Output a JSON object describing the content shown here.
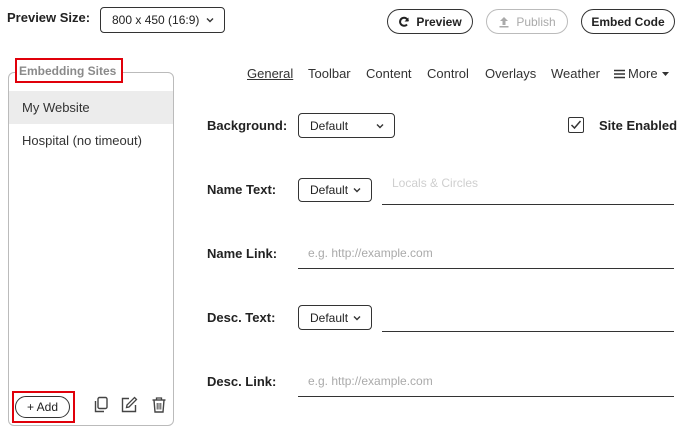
{
  "header": {
    "preview_size_label": "Preview Size:",
    "preview_size_value": "800 x 450 (16:9)",
    "preview_button": "Preview",
    "publish_button": "Publish",
    "embed_code_button": "Embed Code"
  },
  "sidebar": {
    "title": "Embedding Sites",
    "items": [
      {
        "label": "My Website",
        "selected": true
      },
      {
        "label": "Hospital (no timeout)",
        "selected": false
      }
    ],
    "add_button": "+ Add"
  },
  "tabs": [
    {
      "label": "General",
      "active": true
    },
    {
      "label": "Toolbar",
      "active": false
    },
    {
      "label": "Content",
      "active": false
    },
    {
      "label": "Control",
      "active": false
    },
    {
      "label": "Overlays",
      "active": false
    },
    {
      "label": "Weather",
      "active": false
    },
    {
      "label": "More",
      "active": false
    }
  ],
  "form": {
    "background_label": "Background:",
    "background_value": "Default",
    "site_enabled_label": "Site Enabled",
    "site_enabled_checked": true,
    "name_text_label": "Name Text:",
    "name_text_select": "Default",
    "name_text_placeholder": "Locals & Circles",
    "name_link_label": "Name Link:",
    "name_link_placeholder": "e.g. http://example.com",
    "desc_text_label": "Desc. Text:",
    "desc_text_select": "Default",
    "desc_link_label": "Desc. Link:",
    "desc_link_placeholder": "e.g. http://example.com"
  },
  "colors": {
    "highlight_red": "#e0000a",
    "selected_row": "#ececec"
  }
}
